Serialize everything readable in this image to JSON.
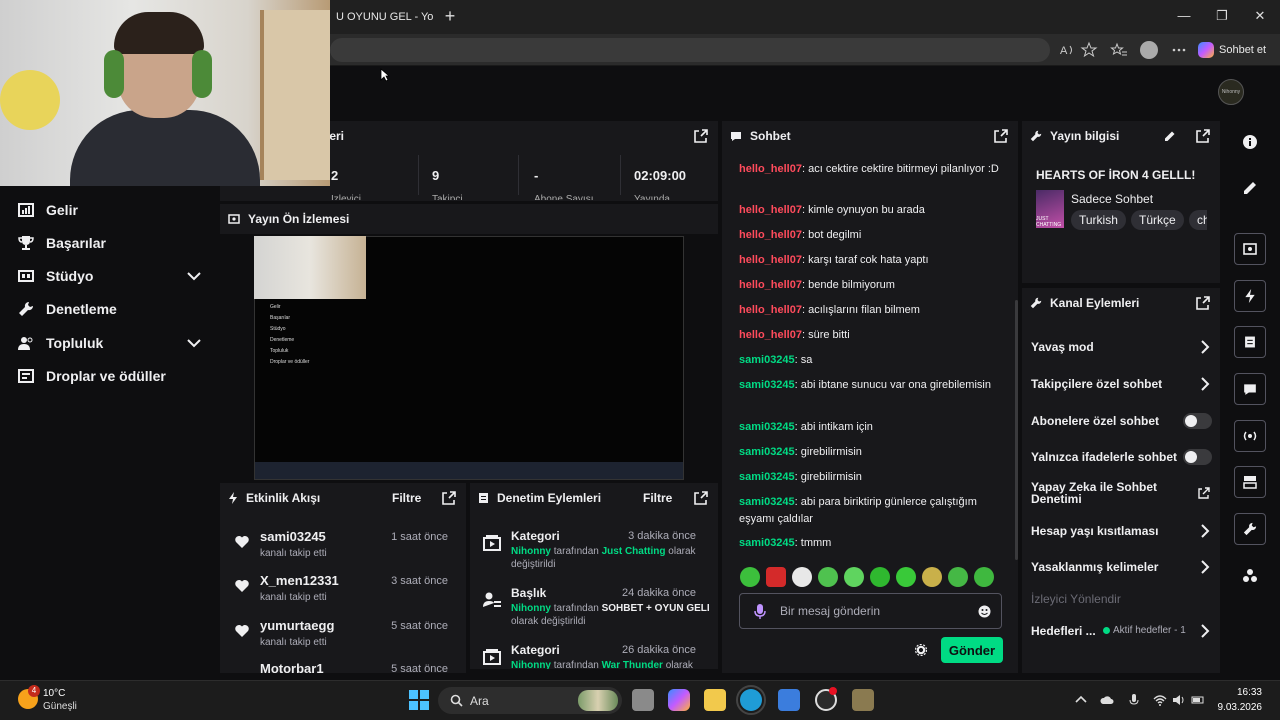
{
  "browser": {
    "tab_title": "U OYUNU GEL - Yo",
    "tab_close": "✕",
    "new_tab": "+",
    "minimize": "—",
    "maximize": "❐",
    "close": "✕",
    "copilot_label": "Sohbet et"
  },
  "channel_logo_text": "Nihonny",
  "sidebar": {
    "items": [
      {
        "label": "Gelir",
        "icon": "chart-icon"
      },
      {
        "label": "Başarılar",
        "icon": "trophy-icon"
      },
      {
        "label": "Stüdyo",
        "icon": "studio-icon",
        "expandable": true
      },
      {
        "label": "Denetleme",
        "icon": "wrench-icon"
      },
      {
        "label": "Topluluk",
        "icon": "community-icon",
        "expandable": true
      },
      {
        "label": "Droplar ve ödüller",
        "icon": "gift-icon"
      }
    ]
  },
  "stats_panel": {
    "title_fragment": "leri",
    "values": [
      "2",
      "9",
      "-",
      "02:09:00"
    ],
    "labels": [
      "İzleyici",
      "Takipçi",
      "Abone Sayısı",
      "Yayında"
    ]
  },
  "preview_panel": {
    "title": "Yayın Ön İzlemesi",
    "mini_sidebar": [
      "Gelir",
      "Başarılar",
      "Stüdyo",
      "Denetleme",
      "Topluluk",
      "Droplar ve ödüller"
    ]
  },
  "activity_feed": {
    "title": "Etkinlik Akışı",
    "filter": "Filtre",
    "items": [
      {
        "name": "sami03245",
        "time": "1 saat önce",
        "action": "kanalı takip etti"
      },
      {
        "name": "X_men12331",
        "time": "3 saat önce",
        "action": "kanalı takip etti"
      },
      {
        "name": "yumurtaegg",
        "time": "5 saat önce",
        "action": "kanalı takip etti"
      },
      {
        "name": "Motorbar1",
        "time": "5 saat önce",
        "action": ""
      }
    ]
  },
  "mod_actions": {
    "title": "Denetim Eylemleri",
    "filter": "Filtre",
    "items": [
      {
        "title": "Kategori",
        "time": "3 dakika önce",
        "user": "Nihonny",
        "by": "tarafından",
        "value": "Just Chatting",
        "suffix": "olarak değiştirildi"
      },
      {
        "title": "Başlık",
        "time": "24 dakika önce",
        "user": "Nihonny",
        "by": "tarafından",
        "value": "SOHBET + OYUN GELI",
        "suffix": "olarak değiştirildi"
      },
      {
        "title": "Kategori",
        "time": "26 dakika önce",
        "user": "Nihonny",
        "by": "tarafından",
        "value": "War Thunder",
        "suffix": "olarak"
      }
    ]
  },
  "chat": {
    "title": "Sohbet",
    "messages": [
      {
        "user": "hello_hell07",
        "text": ": acı cektire cektire bitirmeyi pilanlıyor :D",
        "color": "#ff4b5c"
      },
      {
        "user": "hello_hell07",
        "text": ": kimle oynuyon bu arada",
        "color": "#ff4b5c"
      },
      {
        "user": "hello_hell07",
        "text": ": bot degilmi",
        "color": "#ff4b5c"
      },
      {
        "user": "hello_hell07",
        "text": ": karşı taraf cok hata yaptı",
        "color": "#ff4b5c"
      },
      {
        "user": "hello_hell07",
        "text": ": bende bilmiyorum",
        "color": "#ff4b5c"
      },
      {
        "user": "hello_hell07",
        "text": ": acılışlarını filan bilmem",
        "color": "#ff4b5c"
      },
      {
        "user": "hello_hell07",
        "text": ": süre bitti",
        "color": "#ff4b5c"
      },
      {
        "user": "sami03245",
        "text": ": sa",
        "color": "#00db84"
      },
      {
        "user": "sami03245",
        "text": ": abi ibtane sunucu var ona girebilemisin",
        "color": "#00db84"
      },
      {
        "user": "sami03245",
        "text": ": abi intikam için",
        "color": "#00db84"
      },
      {
        "user": "sami03245",
        "text": ": girebilirmisin",
        "color": "#00db84"
      },
      {
        "user": "sami03245",
        "text": ": girebilirmisin",
        "color": "#00db84"
      },
      {
        "user": "sami03245",
        "text": ": abi para biriktirip günlerce çalıştığım eşyamı çaldılar",
        "color": "#00db84"
      },
      {
        "user": "sami03245",
        "text": ": tmmm",
        "color": "#00db84"
      }
    ],
    "input_placeholder": "Bir mesaj gönderin",
    "send_label": "Gönder"
  },
  "stream_info": {
    "title": "Yayın bilgisi",
    "stream_title": "HEARTS OF İRON 4 GELLL!",
    "category": "Sadece Sohbet",
    "box_art_text": "JUST CHATTING",
    "tags": [
      "Turkish",
      "Türkçe",
      "ch"
    ]
  },
  "channel_actions": {
    "title": "Kanal Eylemleri",
    "items": [
      {
        "label": "Yavaş mod",
        "control": "chevron"
      },
      {
        "label": "Takipçilere özel sohbet",
        "control": "chevron"
      },
      {
        "label": "Abonelere özel sohbet",
        "control": "toggle",
        "enabled": false
      },
      {
        "label": "Yalnızca ifadelerle sohbet",
        "control": "toggle",
        "enabled": false
      },
      {
        "label": "Yapay Zeka ile Sohbet Denetimi",
        "control": "external"
      },
      {
        "label": "Hesap yaşı kısıtlaması",
        "control": "chevron"
      },
      {
        "label": "Yasaklanmış kelimeler",
        "control": "chevron"
      }
    ],
    "section_label": "İzleyici Yönlendir",
    "goals_label": "Hedefleri ...",
    "goals_status": "Aktif hedefler - 1"
  },
  "taskbar": {
    "weather_badge": "4",
    "temperature": "10°C",
    "weather_desc": "Güneşli",
    "search_label": "Ara",
    "time": "16:33",
    "date": "9.03.2026"
  }
}
